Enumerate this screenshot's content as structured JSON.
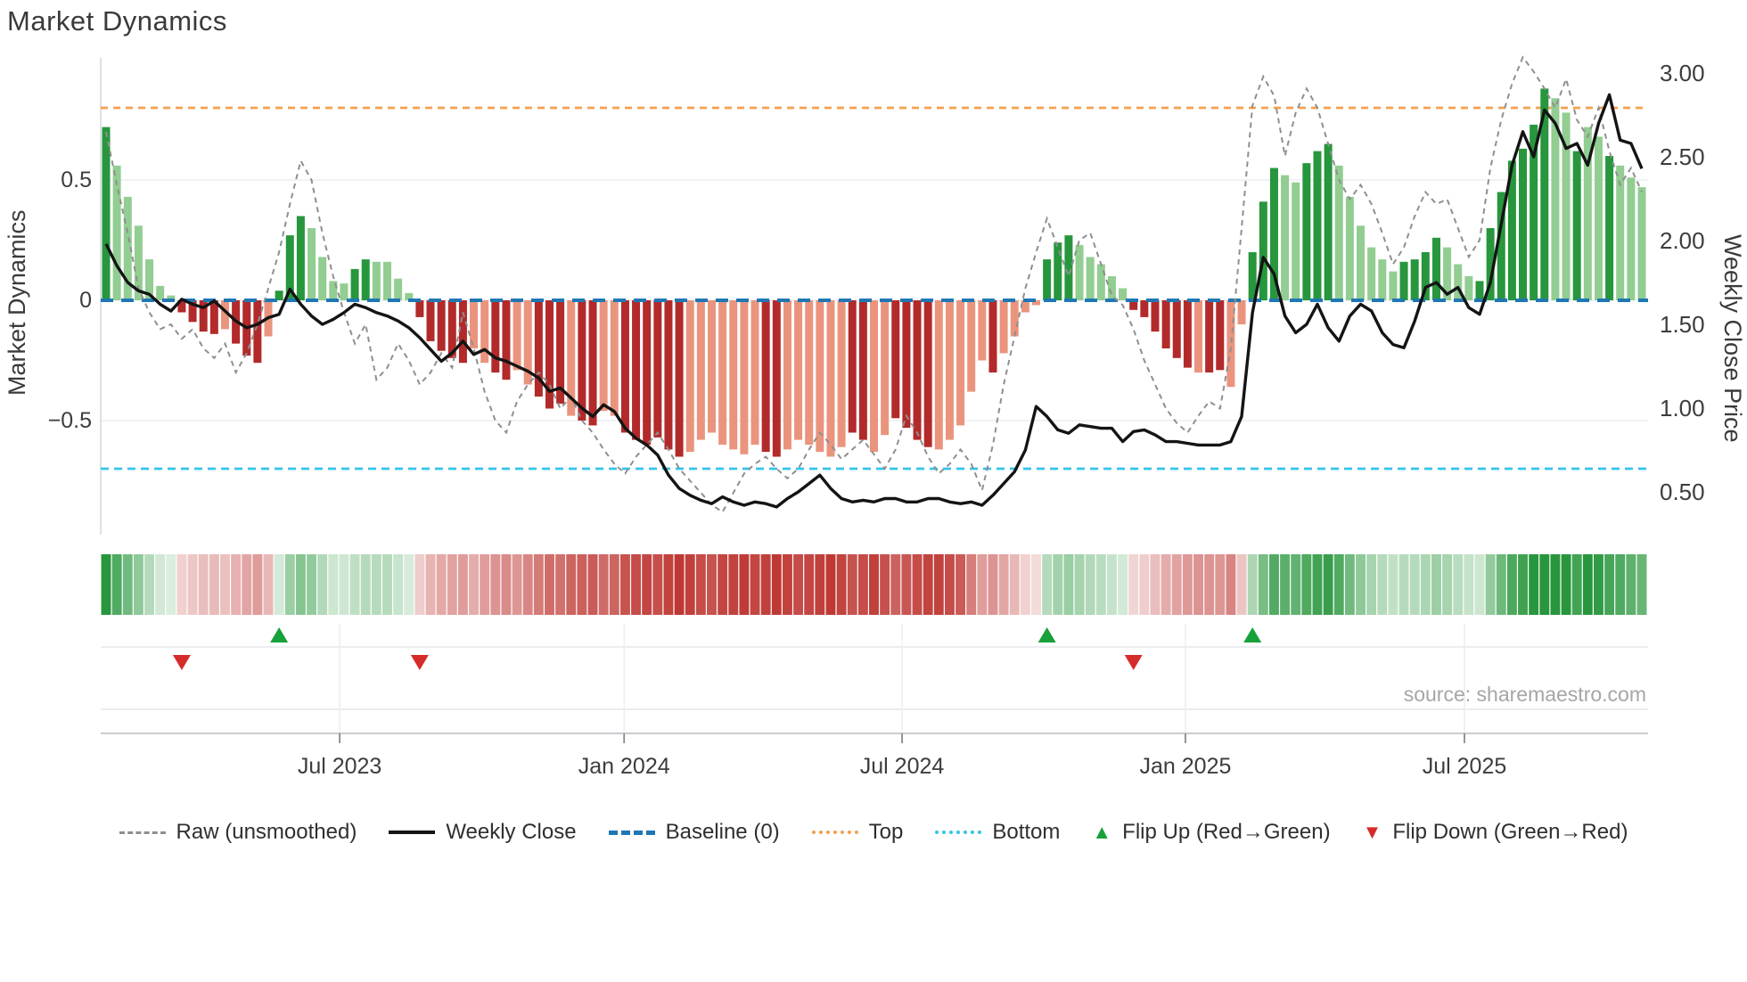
{
  "title": "Market Dynamics",
  "source": "source: sharemaestro.com",
  "left_axis": {
    "label": "Market Dynamics",
    "ticks": [
      {
        "label": "0.5",
        "value": 0.5
      },
      {
        "label": "0",
        "value": 0
      },
      {
        "label": "−0.5",
        "value": -0.5
      }
    ]
  },
  "right_axis": {
    "label": "Weekly Close Price",
    "ticks": [
      {
        "label": "3.00",
        "value": 3.0
      },
      {
        "label": "2.50",
        "value": 2.5
      },
      {
        "label": "2.00",
        "value": 2.0
      },
      {
        "label": "1.50",
        "value": 1.5
      },
      {
        "label": "1.00",
        "value": 1.0
      },
      {
        "label": "0.50",
        "value": 0.5
      }
    ]
  },
  "x_axis": {
    "ticks": [
      {
        "label": "Jul 2023",
        "week": 21.6
      },
      {
        "label": "Jan 2024",
        "week": 47.9
      },
      {
        "label": "Jul 2024",
        "week": 73.6
      },
      {
        "label": "Jan 2025",
        "week": 99.8
      },
      {
        "label": "Jul 2025",
        "week": 125.6
      }
    ]
  },
  "legend": [
    {
      "label": "Raw (unsmoothed)",
      "swatch": "dash",
      "color": "#8f8f8f"
    },
    {
      "label": "Weekly Close",
      "swatch": "solid",
      "color": "#141414"
    },
    {
      "label": "Baseline (0)",
      "swatch": "longdash",
      "color": "#1f77b4"
    },
    {
      "label": "Top",
      "swatch": "dot",
      "color": "#f6a050"
    },
    {
      "label": "Bottom",
      "swatch": "dot",
      "color": "#35c3ea"
    },
    {
      "label": "Flip Up (Red→Green)",
      "swatch": "tri-up",
      "color": "#17a13a"
    },
    {
      "label": "Flip Down (Green→Red)",
      "swatch": "tri-down",
      "color": "#d62b2b"
    }
  ],
  "colors": {
    "bar_dark_green": "#27963c",
    "bar_light_green": "#92cd92",
    "bar_dark_red": "#b22a2a",
    "bar_light_red": "#ea947e",
    "baseline": "#1f77b4",
    "top_line": "#f6a050",
    "bottom_line": "#35c3ea",
    "raw_line": "#8f8f8f",
    "close_line": "#141414",
    "flip_up": "#17a13a",
    "flip_down": "#d62b2b",
    "grid": "#ebeef1",
    "spine": "#c9ccd0"
  },
  "chart_data": {
    "type": "bar",
    "subtype": "composite-oscillator-with-price-overlay",
    "weeks": 143,
    "left_ylim": [
      -0.97,
      1.0
    ],
    "right_ylim": [
      0.25,
      3.09
    ],
    "reference_lines": {
      "baseline": 0,
      "top": 0.8,
      "bottom": -0.7
    },
    "flip_markers": [
      {
        "week": 7,
        "dir": "down"
      },
      {
        "week": 16,
        "dir": "up"
      },
      {
        "week": 29,
        "dir": "down"
      },
      {
        "week": 87,
        "dir": "up"
      },
      {
        "week": 95,
        "dir": "down"
      },
      {
        "week": 106,
        "dir": "up"
      }
    ],
    "series": [
      {
        "name": "Market Dynamics (bars, left axis)",
        "type": "bar",
        "values": [
          0.72,
          0.56,
          0.43,
          0.31,
          0.17,
          0.06,
          0.02,
          -0.05,
          -0.09,
          -0.13,
          -0.14,
          -0.12,
          -0.18,
          -0.23,
          -0.26,
          -0.15,
          0.04,
          0.27,
          0.35,
          0.3,
          0.18,
          0.08,
          0.07,
          0.13,
          0.17,
          0.16,
          0.16,
          0.09,
          0.03,
          -0.07,
          -0.17,
          -0.21,
          -0.24,
          -0.26,
          -0.2,
          -0.26,
          -0.3,
          -0.33,
          -0.29,
          -0.35,
          -0.4,
          -0.45,
          -0.43,
          -0.48,
          -0.5,
          -0.52,
          -0.46,
          -0.48,
          -0.55,
          -0.58,
          -0.6,
          -0.57,
          -0.62,
          -0.65,
          -0.63,
          -0.58,
          -0.55,
          -0.6,
          -0.62,
          -0.64,
          -0.6,
          -0.63,
          -0.65,
          -0.62,
          -0.58,
          -0.6,
          -0.63,
          -0.65,
          -0.61,
          -0.55,
          -0.58,
          -0.63,
          -0.56,
          -0.49,
          -0.53,
          -0.58,
          -0.61,
          -0.62,
          -0.58,
          -0.52,
          -0.38,
          -0.25,
          -0.3,
          -0.22,
          -0.15,
          -0.05,
          -0.02,
          0.17,
          0.24,
          0.27,
          0.23,
          0.18,
          0.15,
          0.1,
          0.05,
          -0.04,
          -0.07,
          -0.13,
          -0.2,
          -0.24,
          -0.28,
          -0.3,
          -0.3,
          -0.29,
          -0.36,
          -0.1,
          0.2,
          0.41,
          0.55,
          0.52,
          0.49,
          0.57,
          0.62,
          0.65,
          0.56,
          0.43,
          0.31,
          0.22,
          0.17,
          0.12,
          0.16,
          0.17,
          0.2,
          0.26,
          0.22,
          0.15,
          0.1,
          0.08,
          0.3,
          0.45,
          0.58,
          0.63,
          0.73,
          0.88,
          0.84,
          0.78,
          0.62,
          0.72,
          0.68,
          0.6,
          0.56,
          0.51,
          0.47
        ],
        "shades": [
          "d",
          "l",
          "l",
          "l",
          "l",
          "l",
          "l",
          "d",
          "d",
          "d",
          "d",
          "l",
          "d",
          "d",
          "d",
          "l",
          "d",
          "d",
          "d",
          "l",
          "l",
          "l",
          "l",
          "d",
          "d",
          "l",
          "l",
          "l",
          "l",
          "d",
          "d",
          "d",
          "d",
          "d",
          "l",
          "l",
          "d",
          "d",
          "l",
          "l",
          "d",
          "d",
          "d",
          "l",
          "d",
          "d",
          "l",
          "l",
          "d",
          "d",
          "d",
          "d",
          "d",
          "d",
          "l",
          "l",
          "l",
          "l",
          "l",
          "l",
          "l",
          "d",
          "d",
          "l",
          "l",
          "l",
          "l",
          "l",
          "l",
          "d",
          "d",
          "l",
          "l",
          "d",
          "d",
          "d",
          "d",
          "l",
          "l",
          "l",
          "l",
          "l",
          "d",
          "l",
          "l",
          "l",
          "l",
          "d",
          "d",
          "d",
          "l",
          "l",
          "l",
          "l",
          "l",
          "d",
          "d",
          "d",
          "d",
          "d",
          "d",
          "l",
          "d",
          "d",
          "l",
          "l",
          "d",
          "d",
          "d",
          "l",
          "l",
          "d",
          "d",
          "d",
          "l",
          "l",
          "l",
          "l",
          "l",
          "l",
          "d",
          "d",
          "d",
          "d",
          "l",
          "l",
          "l",
          "d",
          "d",
          "d",
          "d",
          "d",
          "d",
          "d",
          "l",
          "l",
          "d",
          "l",
          "l",
          "d",
          "l",
          "l",
          "l"
        ]
      },
      {
        "name": "Weekly Close",
        "type": "line",
        "axis": "right",
        "values": [
          1.98,
          1.85,
          1.75,
          1.7,
          1.68,
          1.62,
          1.58,
          1.65,
          1.62,
          1.6,
          1.64,
          1.58,
          1.52,
          1.48,
          1.5,
          1.54,
          1.56,
          1.71,
          1.62,
          1.55,
          1.5,
          1.53,
          1.57,
          1.62,
          1.6,
          1.57,
          1.55,
          1.52,
          1.48,
          1.42,
          1.35,
          1.28,
          1.33,
          1.4,
          1.32,
          1.35,
          1.3,
          1.28,
          1.25,
          1.22,
          1.18,
          1.1,
          1.12,
          1.06,
          1.0,
          0.95,
          1.02,
          0.98,
          0.88,
          0.82,
          0.78,
          0.72,
          0.6,
          0.52,
          0.48,
          0.45,
          0.43,
          0.47,
          0.44,
          0.42,
          0.44,
          0.43,
          0.41,
          0.46,
          0.5,
          0.55,
          0.6,
          0.52,
          0.46,
          0.44,
          0.45,
          0.44,
          0.46,
          0.46,
          0.44,
          0.44,
          0.46,
          0.46,
          0.44,
          0.43,
          0.44,
          0.42,
          0.48,
          0.55,
          0.62,
          0.75,
          1.01,
          0.95,
          0.87,
          0.85,
          0.9,
          0.89,
          0.88,
          0.88,
          0.8,
          0.86,
          0.87,
          0.84,
          0.8,
          0.8,
          0.79,
          0.78,
          0.78,
          0.78,
          0.8,
          0.95,
          1.57,
          1.9,
          1.8,
          1.55,
          1.45,
          1.5,
          1.62,
          1.48,
          1.4,
          1.55,
          1.62,
          1.58,
          1.45,
          1.38,
          1.36,
          1.52,
          1.72,
          1.75,
          1.68,
          1.72,
          1.6,
          1.56,
          1.75,
          2.1,
          2.45,
          2.65,
          2.5,
          2.78,
          2.7,
          2.55,
          2.58,
          2.45,
          2.7,
          2.87,
          2.6,
          2.58,
          2.43
        ]
      },
      {
        "name": "Raw (unsmoothed)",
        "type": "line",
        "axis": "left",
        "values": [
          0.7,
          0.48,
          0.28,
          0.05,
          -0.05,
          -0.12,
          -0.1,
          -0.16,
          -0.12,
          -0.2,
          -0.24,
          -0.18,
          -0.3,
          -0.22,
          -0.1,
          0.05,
          0.2,
          0.4,
          0.58,
          0.5,
          0.28,
          0.1,
          -0.05,
          -0.18,
          -0.1,
          -0.33,
          -0.28,
          -0.18,
          -0.25,
          -0.35,
          -0.3,
          -0.22,
          -0.28,
          -0.05,
          -0.2,
          -0.38,
          -0.5,
          -0.55,
          -0.42,
          -0.35,
          -0.3,
          -0.35,
          -0.45,
          -0.4,
          -0.5,
          -0.55,
          -0.62,
          -0.68,
          -0.72,
          -0.65,
          -0.6,
          -0.55,
          -0.62,
          -0.7,
          -0.75,
          -0.8,
          -0.85,
          -0.88,
          -0.8,
          -0.72,
          -0.68,
          -0.65,
          -0.7,
          -0.74,
          -0.7,
          -0.62,
          -0.55,
          -0.6,
          -0.66,
          -0.62,
          -0.58,
          -0.64,
          -0.7,
          -0.62,
          -0.48,
          -0.55,
          -0.65,
          -0.72,
          -0.68,
          -0.62,
          -0.68,
          -0.79,
          -0.6,
          -0.35,
          -0.15,
          0.05,
          0.2,
          0.34,
          0.22,
          0.1,
          0.25,
          0.28,
          0.15,
          0.02,
          -0.02,
          -0.12,
          -0.25,
          -0.35,
          -0.45,
          -0.51,
          -0.55,
          -0.48,
          -0.42,
          -0.45,
          -0.2,
          0.3,
          0.81,
          0.93,
          0.85,
          0.6,
          0.78,
          0.88,
          0.8,
          0.65,
          0.5,
          0.42,
          0.48,
          0.4,
          0.28,
          0.15,
          0.22,
          0.35,
          0.45,
          0.4,
          0.42,
          0.3,
          0.18,
          0.25,
          0.55,
          0.75,
          0.9,
          1.01,
          0.95,
          0.88,
          0.8,
          0.92,
          0.75,
          0.68,
          0.8,
          0.62,
          0.48,
          0.55,
          0.45
        ]
      }
    ],
    "heatmap": "strip below main panel; per-week cell, green for positive bar value, red for negative, opacity scales with magnitude"
  }
}
